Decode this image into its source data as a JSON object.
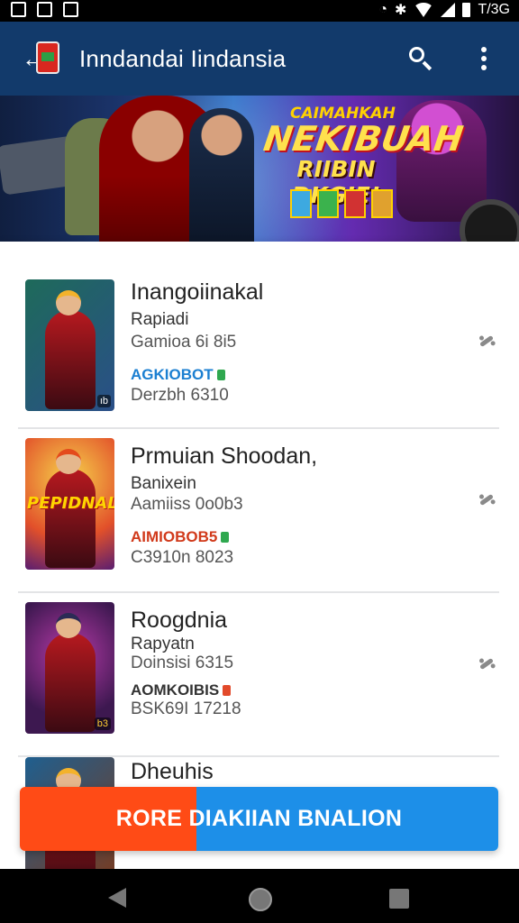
{
  "status_bar": {
    "time": "T/3G"
  },
  "app_bar": {
    "title": "Inndandai Iindansia"
  },
  "banner": {
    "line1": "CAIMAHKAH",
    "line2": "NEKIBUAH",
    "line3": "RIIBIN DKGIE!"
  },
  "games": [
    {
      "title": "Inangoiinakal",
      "subtitle": "Rapiadi",
      "meta": "Gamioa 6i 8i5",
      "tag": "AGKIOBOT",
      "tag_color": "#1b7fd1",
      "tag_dot_color": "#2fa84f",
      "stat": "Derzbh 6310",
      "thumb_badge": "ıb"
    },
    {
      "title": "Prmuian Shoodan,",
      "subtitle": "Banixein",
      "meta": "Aamiiss 0o0b3",
      "tag": "AIMIOBOB5",
      "tag_color": "#d13a1b",
      "tag_dot_color": "#2fa84f",
      "stat": "C3910n 8023",
      "poster_text": "PEPIDNAL"
    },
    {
      "title": "Roogdnia",
      "subtitle": "Rapyatn",
      "meta": "Doinsisi 6315",
      "tag": "AOMKOIBIS",
      "tag_color": "#333333",
      "tag_dot_color": "#e24a2b",
      "stat": "BSK69I 17218",
      "thumb_badge": "b3"
    },
    {
      "title": "Dheuhis"
    }
  ],
  "cta": {
    "label": "RORE DIAKIIAN BNALION"
  }
}
